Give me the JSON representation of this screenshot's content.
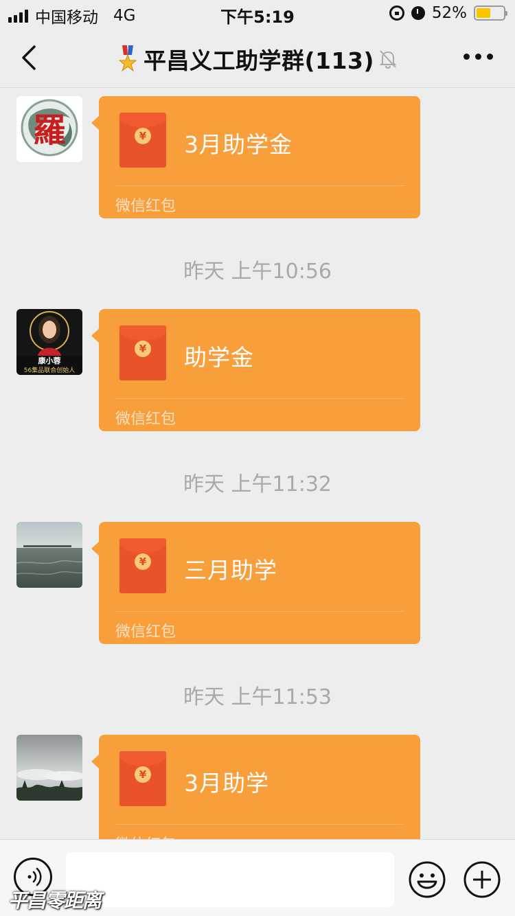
{
  "status_bar": {
    "carrier": "中国移动",
    "network": "4G",
    "time": "下午5:19",
    "battery_percent": "52%",
    "battery_level": 0.52,
    "battery_color": "#f7c600"
  },
  "nav": {
    "title": "平昌义工助学群(113)",
    "icons": [
      "back-icon",
      "medal-icon",
      "mute-bell-icon",
      "more-icon"
    ]
  },
  "messages": [
    {
      "type": "red_packet",
      "title": "3月助学金",
      "subtitle": "微信红包",
      "avatar": "calligraphy-avatar"
    },
    {
      "type": "time",
      "text": "昨天 上午10:56"
    },
    {
      "type": "red_packet",
      "title": "助学金",
      "subtitle": "微信红包",
      "avatar": "portrait-avatar",
      "avatar_text": [
        "康小蓉",
        "56集品联合创始人"
      ]
    },
    {
      "type": "time",
      "text": "昨天 上午11:32"
    },
    {
      "type": "red_packet",
      "title": "三月助学",
      "subtitle": "微信红包",
      "avatar": "sea-avatar"
    },
    {
      "type": "time",
      "text": "昨天 上午11:53"
    },
    {
      "type": "red_packet",
      "title": "3月助学",
      "subtitle": "微信红包",
      "avatar": "clouds-avatar"
    }
  ],
  "input_bar": {
    "placeholder": "",
    "icons": [
      "voice-icon",
      "emoji-icon",
      "plus-icon"
    ]
  },
  "watermark": "平昌零距离",
  "colors": {
    "background": "#ededed",
    "red_packet": "#f89e3a",
    "envelope": "#e8532c",
    "time_label": "#a9a9a9"
  }
}
